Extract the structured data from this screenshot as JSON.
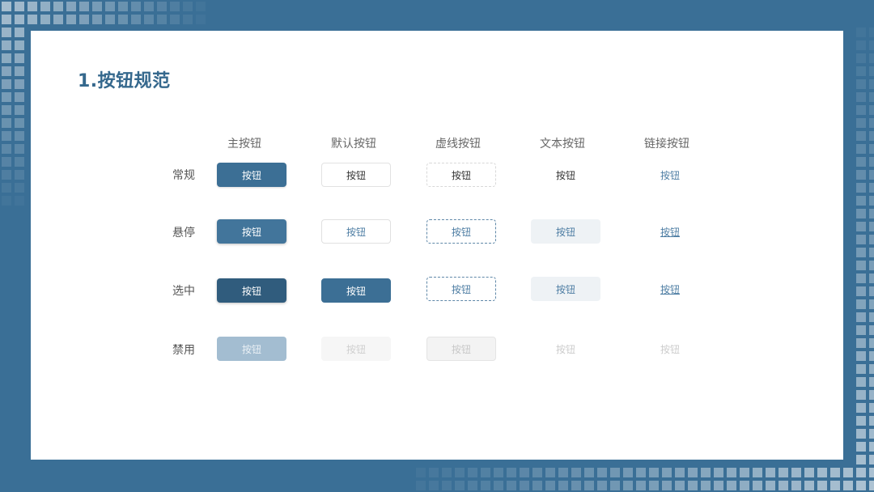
{
  "slide": {
    "title": "1.按钮规范"
  },
  "columns": [
    "主按钮",
    "默认按钮",
    "虚线按钮",
    "文本按钮",
    "链接按钮"
  ],
  "rows": [
    "常规",
    "悬停",
    "选中",
    "禁用"
  ],
  "button_label": "按钮",
  "colors": {
    "brand": "#3c6f95",
    "brand_active": "#305c7d",
    "brand_disabled": "#a3bdd1",
    "link": "#4d7da3",
    "hover_bg": "#eef2f5",
    "disabled_text": "#cccccc"
  }
}
